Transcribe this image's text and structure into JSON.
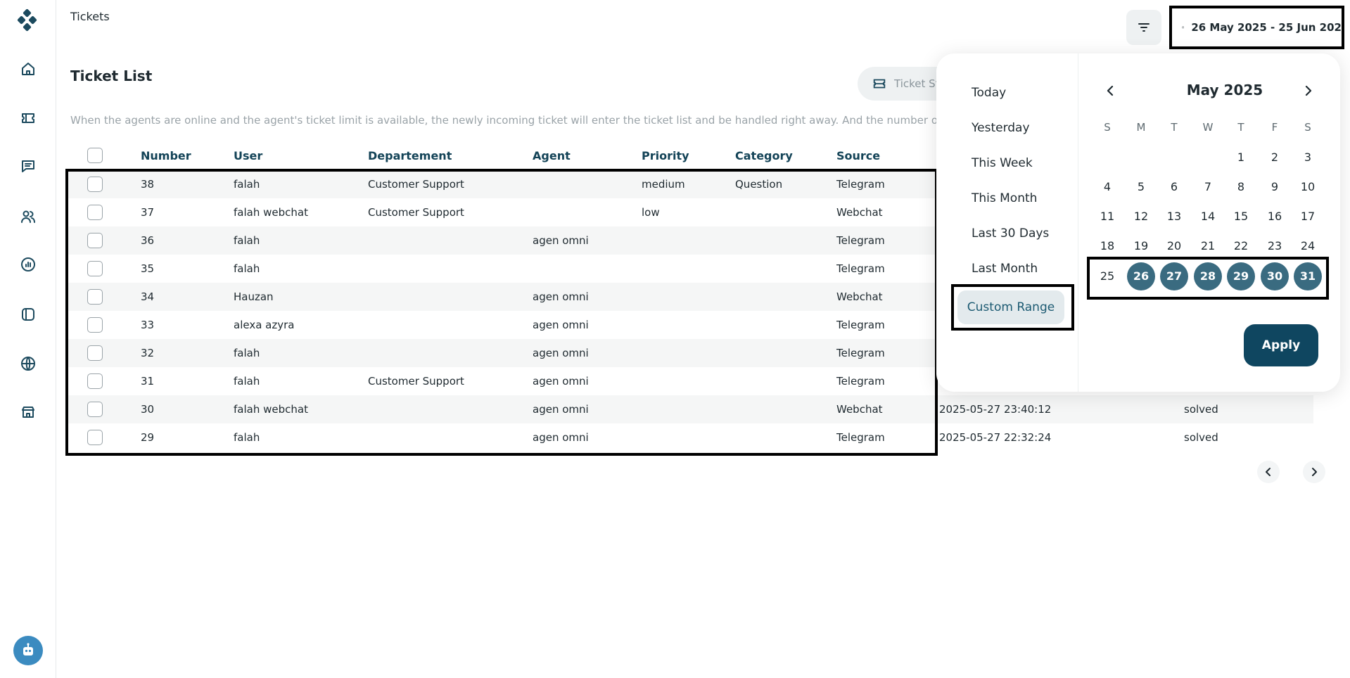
{
  "header": {
    "crumb": "Tickets",
    "date_range": "26 May 2025 - 25 Jun 202"
  },
  "sidebar": {
    "items": [
      "home-icon",
      "ticket-icon",
      "chat-icon",
      "users-icon",
      "analytics-icon",
      "channel-icon",
      "globe-icon",
      "store-icon"
    ]
  },
  "page": {
    "title": "Ticket List",
    "stat_button": "Ticket St",
    "hint": "When the agents are online and the agent's ticket limit is available, the newly incoming ticket will enter the ticket list and be handled right away. And the number of tickets in a spe"
  },
  "table": {
    "columns": [
      "Number",
      "User",
      "Departement",
      "Agent",
      "Priority",
      "Category",
      "Source"
    ],
    "rows": [
      {
        "number": "38",
        "user": "falah",
        "dept": "Customer Support",
        "agent": "",
        "priority": "medium",
        "category": "Question",
        "source": "Telegram"
      },
      {
        "number": "37",
        "user": "falah webchat",
        "dept": "Customer Support",
        "agent": "",
        "priority": "low",
        "category": "",
        "source": "Webchat"
      },
      {
        "number": "36",
        "user": "falah",
        "dept": "",
        "agent": "agen omni",
        "priority": "",
        "category": "",
        "source": "Telegram"
      },
      {
        "number": "35",
        "user": "falah",
        "dept": "",
        "agent": "",
        "priority": "",
        "category": "",
        "source": "Telegram"
      },
      {
        "number": "34",
        "user": "Hauzan",
        "dept": "",
        "agent": "agen omni",
        "priority": "",
        "category": "",
        "source": "Webchat"
      },
      {
        "number": "33",
        "user": "alexa azyra",
        "dept": "",
        "agent": "agen omni",
        "priority": "",
        "category": "",
        "source": "Telegram"
      },
      {
        "number": "32",
        "user": "falah",
        "dept": "",
        "agent": "agen omni",
        "priority": "",
        "category": "",
        "source": "Telegram"
      },
      {
        "number": "31",
        "user": "falah",
        "dept": "Customer Support",
        "agent": "agen omni",
        "priority": "",
        "category": "",
        "source": "Telegram"
      },
      {
        "number": "30",
        "user": "falah webchat",
        "dept": "",
        "agent": "agen omni",
        "priority": "",
        "category": "",
        "source": "Webchat",
        "date": "2025-05-27 23:40:12",
        "status": "solved"
      },
      {
        "number": "29",
        "user": "falah",
        "dept": "",
        "agent": "agen omni",
        "priority": "",
        "category": "",
        "source": "Telegram",
        "date": "2025-05-27 22:32:24",
        "status": "solved"
      }
    ]
  },
  "picker": {
    "presets": [
      "Today",
      "Yesterday",
      "This Week",
      "This Month",
      "Last 30 Days",
      "Last Month",
      "Custom Range"
    ],
    "month": "May 2025",
    "weekdays": [
      "S",
      "M",
      "T",
      "W",
      "T",
      "F",
      "S"
    ],
    "weeks": [
      [
        "",
        "",
        "",
        "",
        "1",
        "2",
        "3"
      ],
      [
        "4",
        "5",
        "6",
        "7",
        "8",
        "9",
        "10"
      ],
      [
        "11",
        "12",
        "13",
        "14",
        "15",
        "16",
        "17"
      ],
      [
        "18",
        "19",
        "20",
        "21",
        "22",
        "23",
        "24"
      ],
      [
        "25",
        "26",
        "27",
        "28",
        "29",
        "30",
        "31"
      ]
    ],
    "selected": [
      "26",
      "27",
      "28",
      "29",
      "30",
      "31"
    ],
    "apply": "Apply"
  },
  "colors": {
    "accent": "#0f4660",
    "selected_day": "#3a6b80",
    "header_text": "#134357"
  }
}
